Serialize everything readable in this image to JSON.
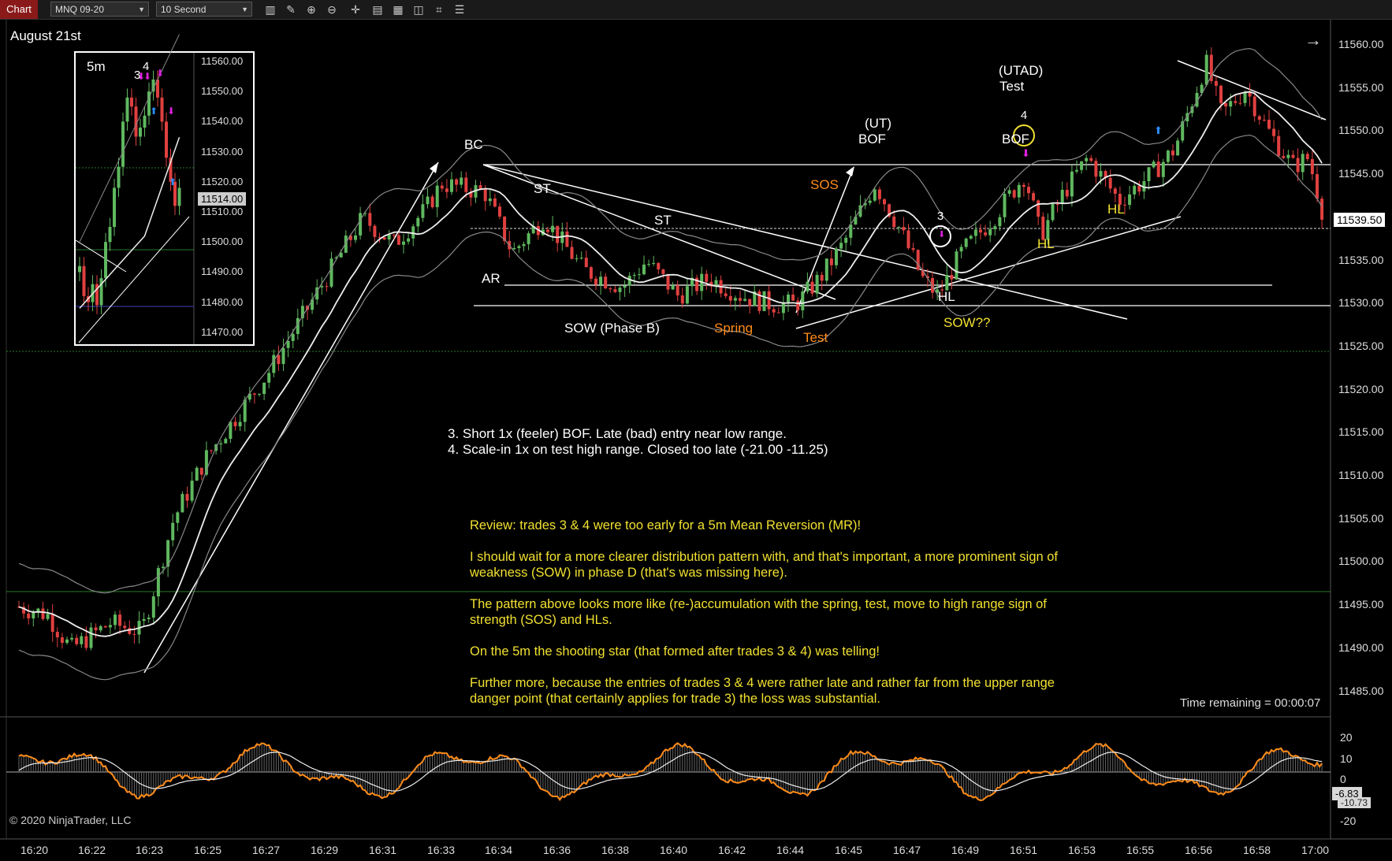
{
  "toolbar": {
    "tab": "Chart",
    "instrument": "MNQ 09-20",
    "interval": "10 Second",
    "icons": [
      "bars-type-icon",
      "pencil-draw-icon",
      "zoom-in-icon",
      "zoom-out-icon",
      "crosshair-icon",
      "data-box-icon",
      "chart-properties-icon",
      "indicators-icon",
      "strategies-icon",
      "chart-trader-icon"
    ]
  },
  "chart": {
    "date_label": "August 21st",
    "copyright": "© 2020 NinjaTrader, LLC",
    "time_remaining": "Time remaining = 00:00:07",
    "price_ticks": [
      "11560.00",
      "11555.00",
      "11550.00",
      "11545.00",
      "11540.00",
      "11535.00",
      "11530.00",
      "11525.00",
      "11520.00",
      "11515.00",
      "11510.00",
      "11505.00",
      "11500.00",
      "11495.00",
      "11490.00",
      "11485.00"
    ],
    "last_price": "11539.50",
    "osc_ticks": [
      "20",
      "10",
      "0",
      "-10",
      "-20"
    ],
    "osc_values": [
      "-6.83",
      "-10.73"
    ],
    "time_ticks": [
      "16:20",
      "16:22",
      "16:23",
      "16:25",
      "16:27",
      "16:29",
      "16:31",
      "16:33",
      "16:34",
      "16:36",
      "16:38",
      "16:40",
      "16:42",
      "16:44",
      "16:45",
      "16:47",
      "16:49",
      "16:51",
      "16:53",
      "16:55",
      "16:56",
      "16:58",
      "17:00"
    ],
    "annotations": {
      "bc": "BC",
      "st1": "ST",
      "st2": "ST",
      "ar": "AR",
      "sow_b": "SOW (Phase B)",
      "spring": "Spring",
      "test": "Test",
      "sos": "SOS",
      "ut": "(UT)",
      "bof1": "BOF",
      "utad": "(UTAD)",
      "utad_test": "Test",
      "bof2": "BOF",
      "circle3": "3",
      "circle4": "4",
      "hl1": "HL",
      "hl2": "HL",
      "hl3": "HL",
      "sowqq": "SOW??"
    },
    "notes": [
      "3. Short 1x (feeler) BOF. Late (bad) entry near low range.",
      "4. Scale-in 1x on test high range. Closed too late (-21.00 -11.25)"
    ],
    "review": [
      "Review: trades 3 & 4 were too early for a 5m Mean Reversion (MR)!",
      "I should wait for a more clearer distribution pattern with, and that's important, a more prominent sign of",
      "weakness (SOW) in phase D (that's was missing here).",
      "The pattern above looks more like (re-)accumulation with the spring, test, move to high range sign of",
      "strength (SOS) and HLs.",
      "On the 5m the shooting star (that formed after trades 3 & 4) was telling!",
      "Further more, because the entries of trades 3 & 4 were rather late and rather far from the upper range",
      "danger point (that certainly applies for trade 3) the loss was substantial."
    ]
  },
  "inset": {
    "label": "5m",
    "marker3": "3",
    "marker4": "4",
    "price_ticks": [
      "11560.00",
      "11550.00",
      "11540.00",
      "11530.00",
      "11520.00",
      "11510.00",
      "11500.00",
      "11490.00",
      "11480.00",
      "11470.00"
    ],
    "last_price": "11514.00"
  },
  "colors": {
    "up": "#5fb85f",
    "down": "#e04040",
    "yellow": "#f0e030",
    "orange": "#ff8c1a",
    "magenta": "#e020e0",
    "blue": "#2a8cff"
  }
}
